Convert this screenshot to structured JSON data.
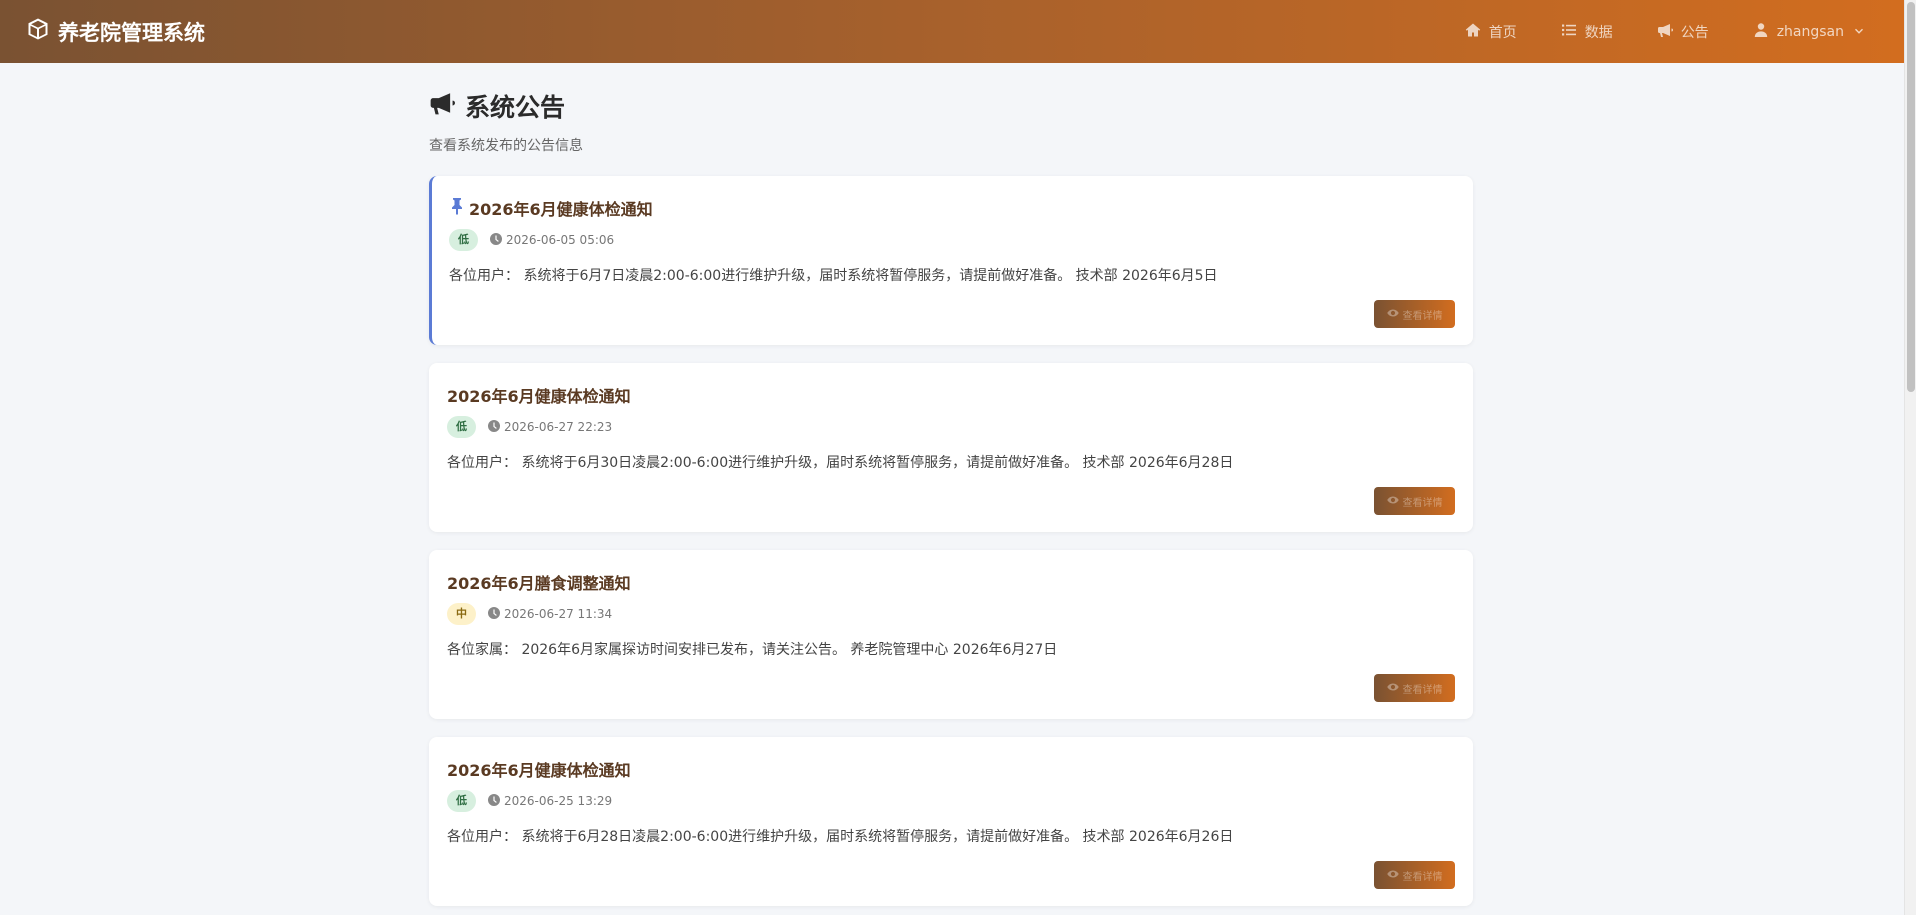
{
  "navbar": {
    "brand": "养老院管理系统",
    "links": {
      "home": "首页",
      "data": "数据",
      "notice": "公告",
      "user": "zhangsan"
    }
  },
  "page": {
    "title": "系统公告",
    "subtitle": "查看系统发布的公告信息"
  },
  "notices": [
    {
      "title": "2026年6月健康体检通知",
      "pinned": true,
      "priority": "低",
      "time": "2026-06-05 05:06",
      "content": "各位用户： 系统将于6月7日凌晨2:00-6:00进行维护升级，届时系统将暂停服务，请提前做好准备。 技术部 2026年6月5日",
      "button": "查看详情"
    },
    {
      "title": "2026年6月健康体检通知",
      "pinned": false,
      "priority": "低",
      "time": "2026-06-27 22:23",
      "content": "各位用户： 系统将于6月30日凌晨2:00-6:00进行维护升级，届时系统将暂停服务，请提前做好准备。 技术部 2026年6月28日",
      "button": "查看详情"
    },
    {
      "title": "2026年6月膳食调整通知",
      "pinned": false,
      "priority": "中",
      "time": "2026-06-27 11:34",
      "content": "各位家属： 2026年6月家属探访时间安排已发布，请关注公告。 养老院管理中心 2026年6月27日",
      "button": "查看详情"
    },
    {
      "title": "2026年6月健康体检通知",
      "pinned": false,
      "priority": "低",
      "time": "2026-06-25 13:29",
      "content": "各位用户： 系统将于6月28日凌晨2:00-6:00进行维护升级，届时系统将暂停服务，请提前做好准备。 技术部 2026年6月26日",
      "button": "查看详情"
    }
  ],
  "colors": {
    "nav_start": "#7a5232",
    "nav_end": "#d26d1f",
    "pin_accent": "#5b7bd5",
    "badge_low_bg": "#d7efdf",
    "badge_mid_bg": "#fdf1c9"
  }
}
